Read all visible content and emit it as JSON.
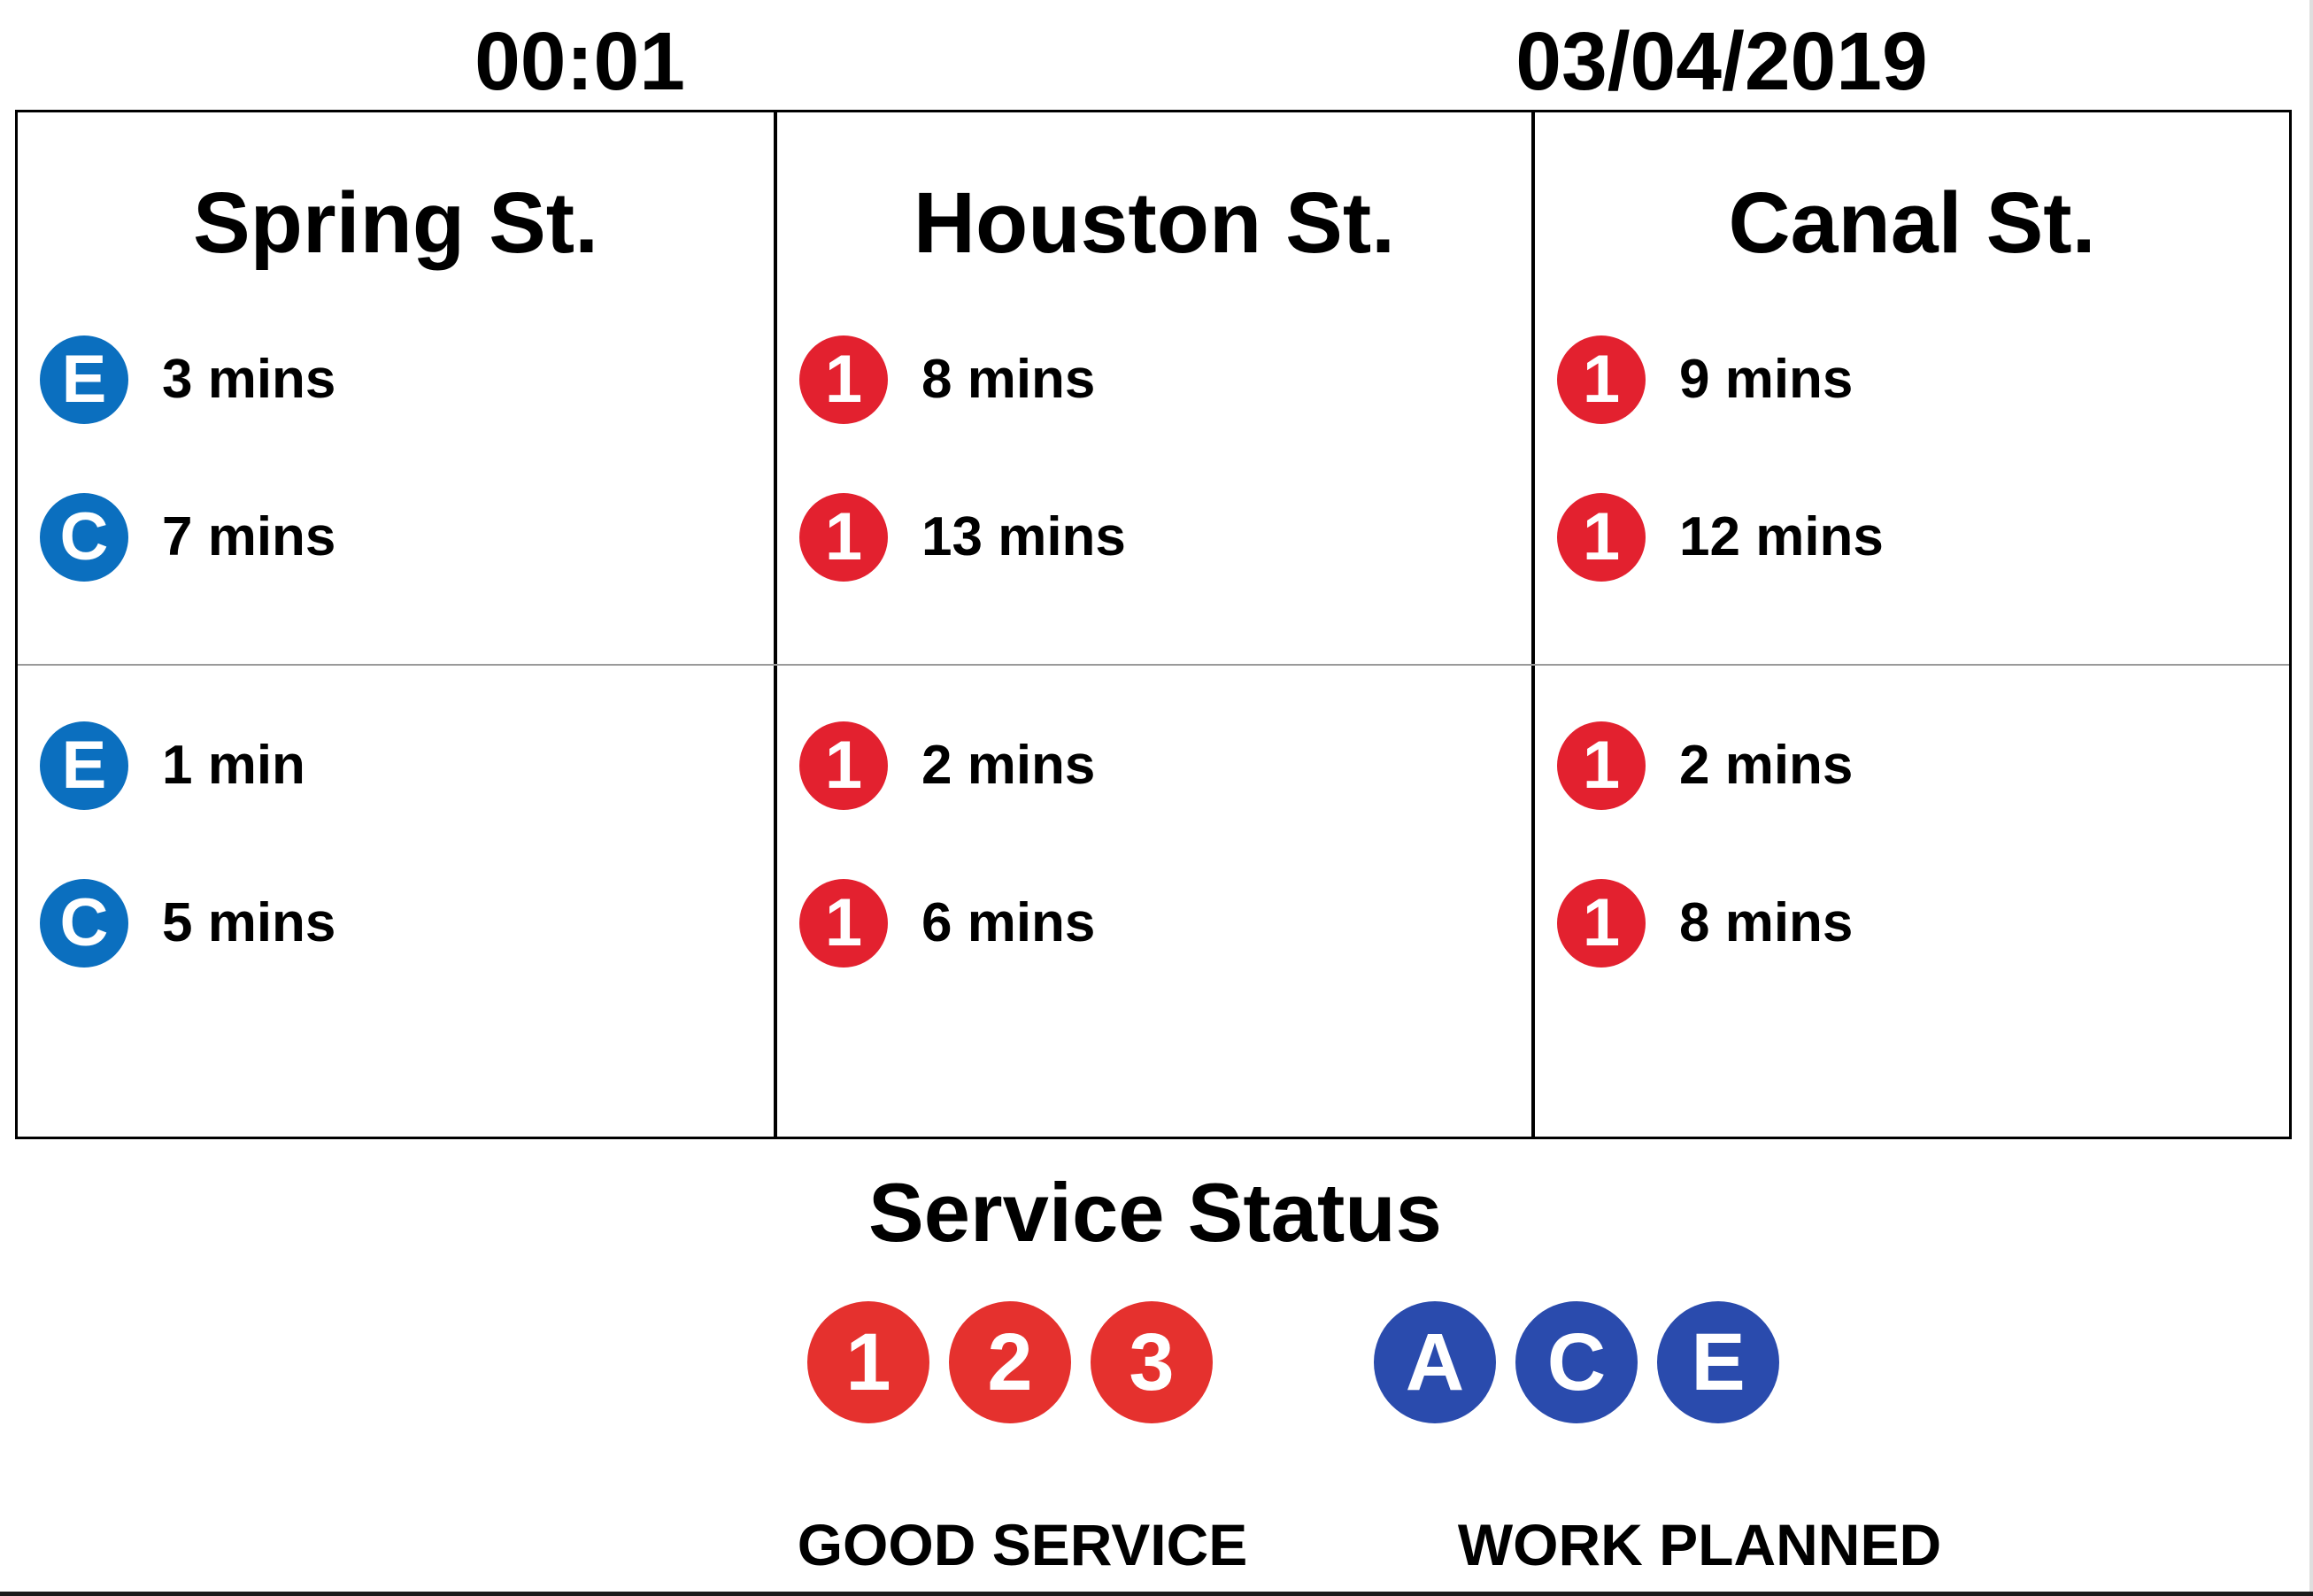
{
  "header": {
    "time": "00:01",
    "date": "03/04/2019"
  },
  "colors": {
    "ace_blue_bullet": "#0b6fbf",
    "line_123_red": "#e3212f",
    "status_red": "#e5312e",
    "status_navy": "#2a4bad"
  },
  "stations": [
    {
      "name": "Spring St.",
      "top": [
        {
          "line": "E",
          "time": "3 mins",
          "color": "blue"
        },
        {
          "line": "C",
          "time": "7 mins",
          "color": "blue"
        }
      ],
      "bottom": [
        {
          "line": "E",
          "time": "1 min",
          "color": "blue"
        },
        {
          "line": "C",
          "time": "5 mins",
          "color": "blue"
        }
      ]
    },
    {
      "name": "Houston St.",
      "top": [
        {
          "line": "1",
          "time": "8 mins",
          "color": "red"
        },
        {
          "line": "1",
          "time": "13 mins",
          "color": "red"
        }
      ],
      "bottom": [
        {
          "line": "1",
          "time": "2 mins",
          "color": "red"
        },
        {
          "line": "1",
          "time": "6 mins",
          "color": "red"
        }
      ]
    },
    {
      "name": "Canal St.",
      "top": [
        {
          "line": "1",
          "time": "9 mins",
          "color": "red"
        },
        {
          "line": "1",
          "time": "12 mins",
          "color": "red"
        }
      ],
      "bottom": [
        {
          "line": "1",
          "time": "2 mins",
          "color": "red"
        },
        {
          "line": "1",
          "time": "8 mins",
          "color": "red"
        }
      ]
    }
  ],
  "service_status": {
    "title": "Service Status",
    "groups": [
      {
        "lines": [
          "1",
          "2",
          "3"
        ],
        "status": "GOOD SERVICE",
        "color": "red"
      },
      {
        "lines": [
          "A",
          "C",
          "E"
        ],
        "status": "WORK PLANNED",
        "color": "navy"
      }
    ]
  }
}
